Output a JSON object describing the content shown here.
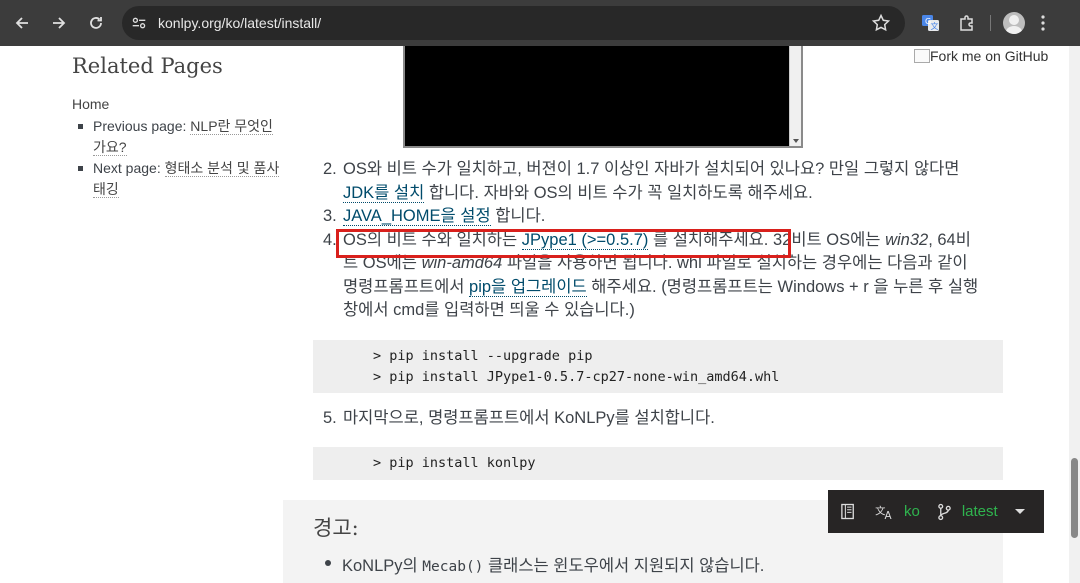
{
  "browser": {
    "url": "konlpy.org/ko/latest/install/"
  },
  "sidebar": {
    "title": "Related Pages",
    "home": "Home",
    "items": [
      {
        "prefix": "Previous page: ",
        "link": "NLP란 무엇인가요?"
      },
      {
        "prefix": "Next page: ",
        "link": "형태소 분석 및 품사 태깅"
      }
    ]
  },
  "fork": "Fork me on GitHub",
  "steps": {
    "s2": {
      "num": "2.",
      "line1": "OS와 비트 수가 일치하고, 버젼이 1.7 이상인 자바가 설치되어 있나요? 만일 그렇지 않다면 ",
      "link": "JDK를 설치",
      "line2": " 합니다. 자바와 OS의 비트 수가 꼭 일치하도록 해주세요."
    },
    "s3": {
      "num": "3.",
      "link": "JAVA_HOME을 설정",
      "tail": " 합니다."
    },
    "s4": {
      "num": "4.",
      "a": "OS의 비트 수와 일치하는 ",
      "link1": "JPype1 (>=0.5.7)",
      "b": " 를 설치해주세요. 32비트 OS에는 ",
      "em1": "win32",
      "c": ", 64비트 OS에는 ",
      "em2": "win-amd64",
      "d": " 파일을 사용하면 됩니다. whl 파일로 설치하는 경우에는 다음과 같이 명령프롬프트에서 ",
      "link2": "pip을 업그레이드",
      "e": " 해주세요. (명령프롬프트는 Windows + r 을 누른 후 실행창에서 cmd를 입력하면 띄울 수 있습니다.)"
    },
    "s5": {
      "num": "5.",
      "text": "마지막으로, 명령프롬프트에서 KoNLPy를 설치합니다."
    }
  },
  "code1": "> pip install --upgrade pip\n> pip install JPype1-0.5.7-cp27-none-win_amd64.whl",
  "code2": "> pip install konlpy",
  "warning": {
    "title": "경고:",
    "a": "KoNLPy의 ",
    "code": "Mecab()",
    "b": " 클래스는 윈도우에서 지원되지 않습니다."
  },
  "rtd": {
    "language": "ko",
    "version": "latest"
  },
  "colors": {
    "highlight": "#d9201c",
    "rtd_green": "#2fb34e",
    "link": "#004b6b"
  }
}
